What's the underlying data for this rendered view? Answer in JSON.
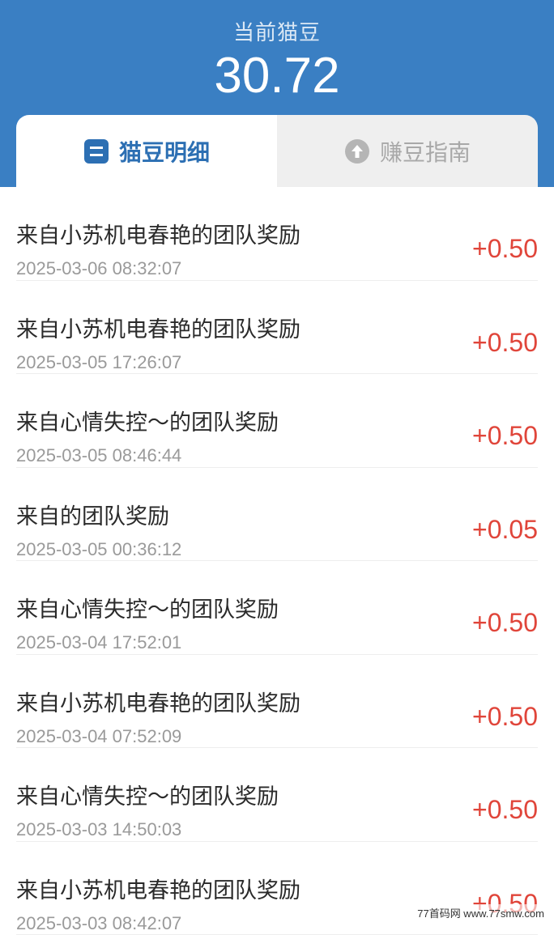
{
  "header": {
    "balance_label": "当前猫豆",
    "balance_value": "30.72"
  },
  "tabs": [
    {
      "label": "猫豆明细",
      "icon": "list-icon",
      "active": true
    },
    {
      "label": "赚豆指南",
      "icon": "arrow-up-circle-icon",
      "active": false
    }
  ],
  "records": [
    {
      "title": "来自小苏机电春艳的团队奖励",
      "time": "2025-03-06 08:32:07",
      "amount": "+0.50"
    },
    {
      "title": "来自小苏机电春艳的团队奖励",
      "time": "2025-03-05 17:26:07",
      "amount": "+0.50"
    },
    {
      "title": "来自心情失控～的团队奖励",
      "time": "2025-03-05 08:46:44",
      "amount": "+0.50"
    },
    {
      "title": "来自的团队奖励",
      "time": "2025-03-05 00:36:12",
      "amount": "+0.05"
    },
    {
      "title": "来自心情失控～的团队奖励",
      "time": "2025-03-04 17:52:01",
      "amount": "+0.50"
    },
    {
      "title": "来自小苏机电春艳的团队奖励",
      "time": "2025-03-04 07:52:09",
      "amount": "+0.50"
    },
    {
      "title": "来自心情失控～的团队奖励",
      "time": "2025-03-03 14:50:03",
      "amount": "+0.50"
    },
    {
      "title": "来自小苏机电春艳的团队奖励",
      "time": "2025-03-03 08:42:07",
      "amount": "+0.50"
    }
  ],
  "watermark": "77首码网 www.77smw.com",
  "colors": {
    "header_bg": "#3a7fc3",
    "active_tab_text": "#2c6fb3",
    "amount_positive": "#e0453a"
  }
}
